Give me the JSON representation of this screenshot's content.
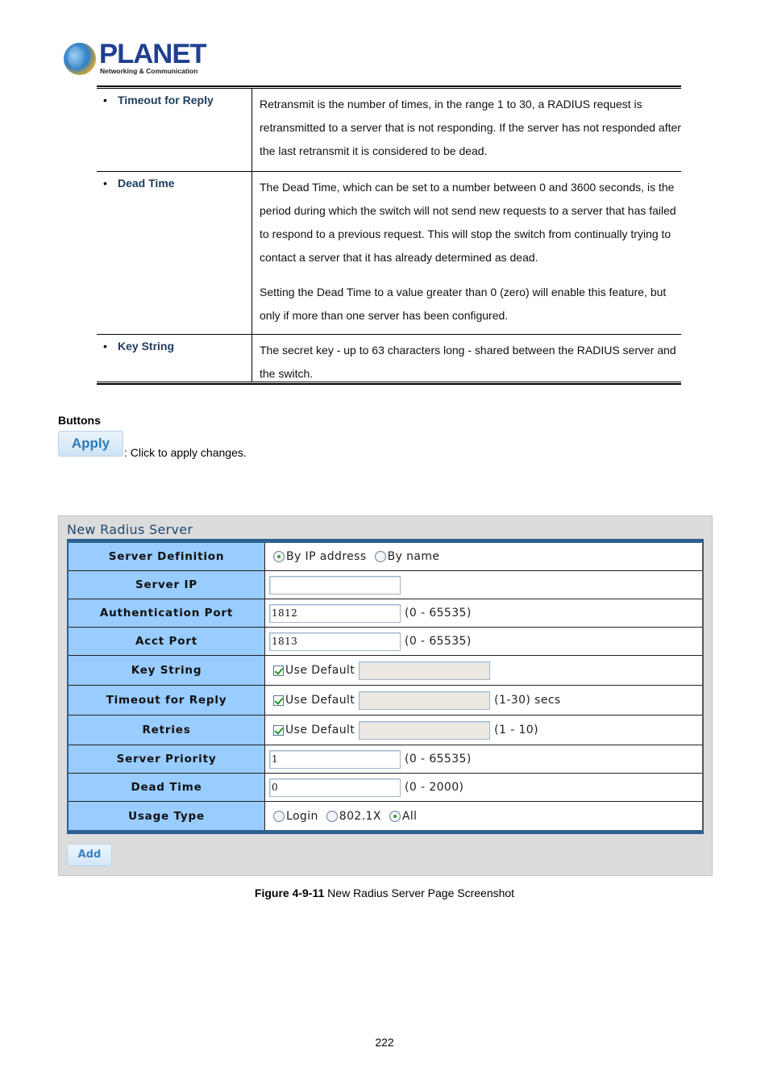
{
  "header": {
    "logo_text": "PLANET",
    "logo_tagline": "Networking & Communication"
  },
  "description_table": [
    {
      "term": "Timeout for Reply",
      "paragraphs": [
        "Retransmit is the number of times, in the range 1 to 30, a RADIUS request is retransmitted to a server that is not responding. If the server has not responded after the last retransmit it is considered to be dead."
      ]
    },
    {
      "term": "Dead Time",
      "paragraphs": [
        "The Dead Time, which can be set to a number between 0 and 3600 seconds, is the period during which the switch will not send new requests to a server that has failed to respond to a previous request. This will stop the switch from continually trying to contact a server that it has already determined as dead.",
        "Setting the Dead Time to a value greater than 0 (zero) will enable this feature, but only if more than one server has been configured."
      ]
    },
    {
      "term": "Key String",
      "paragraphs": [
        "The secret key - up to 63 characters long - shared between the RADIUS server and the switch."
      ]
    }
  ],
  "buttons_section": {
    "heading": "Buttons",
    "apply_label": "Apply",
    "apply_description": ": Click to apply changes."
  },
  "form": {
    "title": "New Radius Server",
    "rows": {
      "server_definition": {
        "label": "Server Definition",
        "options": [
          {
            "label": "By IP address",
            "selected": true
          },
          {
            "label": "By name",
            "selected": false
          }
        ]
      },
      "server_ip": {
        "label": "Server IP",
        "value": ""
      },
      "auth_port": {
        "label": "Authentication Port",
        "value": "1812",
        "hint": "(0 - 65535)"
      },
      "acct_port": {
        "label": "Acct Port",
        "value": "1813",
        "hint": "(0 - 65535)"
      },
      "key_string": {
        "label": "Key String",
        "checkbox_label": "Use Default",
        "checked": true,
        "value": ""
      },
      "timeout": {
        "label": "Timeout for Reply",
        "checkbox_label": "Use Default",
        "checked": true,
        "value": "",
        "hint": "(1-30) secs"
      },
      "retries": {
        "label": "Retries",
        "checkbox_label": "Use Default",
        "checked": true,
        "value": "",
        "hint": "(1 - 10)"
      },
      "priority": {
        "label": "Server Priority",
        "value": "1",
        "hint": "(0 - 65535)"
      },
      "dead_time": {
        "label": "Dead Time",
        "value": "0",
        "hint": "(0 - 2000)"
      },
      "usage_type": {
        "label": "Usage Type",
        "options": [
          {
            "label": "Login",
            "selected": false
          },
          {
            "label": "802.1X",
            "selected": false
          },
          {
            "label": "All",
            "selected": true
          }
        ]
      }
    },
    "add_label": "Add"
  },
  "caption": {
    "figure_number": "Figure 4-9-11",
    "text": " New Radius Server Page Screenshot"
  },
  "page_number": "222"
}
